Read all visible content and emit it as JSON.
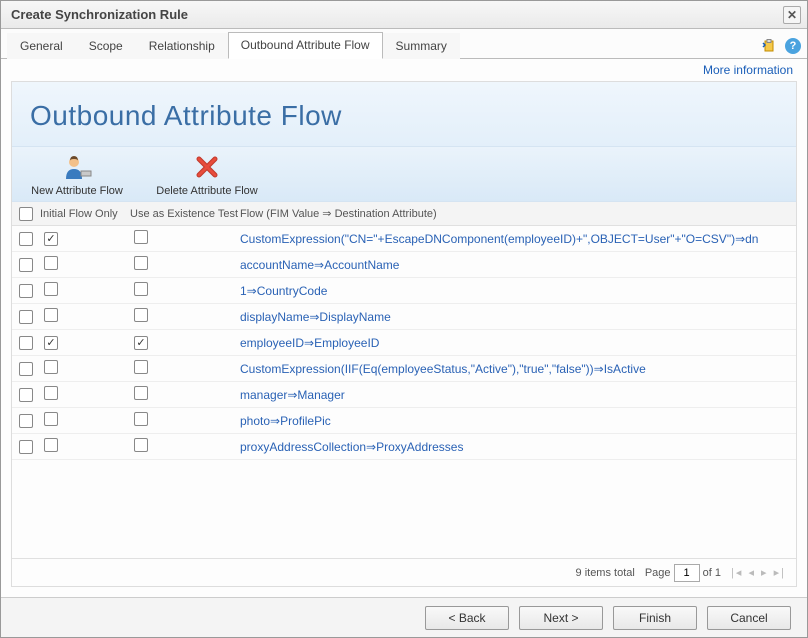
{
  "dialog": {
    "title": "Create Synchronization Rule"
  },
  "tabs": [
    "General",
    "Scope",
    "Relationship",
    "Outbound Attribute Flow",
    "Summary"
  ],
  "active_tab_index": 3,
  "more_info": "More information",
  "panel": {
    "title": "Outbound Attribute Flow"
  },
  "toolbar": {
    "new_flow": "New Attribute Flow",
    "delete_flow": "Delete Attribute Flow"
  },
  "columns": {
    "initial_flow_only": "Initial Flow Only",
    "use_existence_test": "Use as Existence Test",
    "flow": "Flow (FIM Value ⇒ Destination Attribute)"
  },
  "rows": [
    {
      "ifo": true,
      "uet": false,
      "flow": "CustomExpression(\"CN=\"+EscapeDNComponent(employeeID)+\",OBJECT=User\"+\"O=CSV\")⇒dn"
    },
    {
      "ifo": false,
      "uet": false,
      "flow": "accountName⇒AccountName"
    },
    {
      "ifo": false,
      "uet": false,
      "flow": "1⇒CountryCode"
    },
    {
      "ifo": false,
      "uet": false,
      "flow": "displayName⇒DisplayName"
    },
    {
      "ifo": true,
      "uet": true,
      "flow": "employeeID⇒EmployeeID"
    },
    {
      "ifo": false,
      "uet": false,
      "flow": "CustomExpression(IIF(Eq(employeeStatus,\"Active\"),\"true\",\"false\"))⇒IsActive"
    },
    {
      "ifo": false,
      "uet": false,
      "flow": "manager⇒Manager"
    },
    {
      "ifo": false,
      "uet": false,
      "flow": "photo⇒ProfilePic"
    },
    {
      "ifo": false,
      "uet": false,
      "flow": "proxyAddressCollection⇒ProxyAddresses"
    }
  ],
  "pager": {
    "total_text": "9 items total",
    "page_label": "Page",
    "page_value": "1",
    "of_text": "of 1"
  },
  "footer": {
    "back": "< Back",
    "next": "Next >",
    "finish": "Finish",
    "cancel": "Cancel"
  }
}
